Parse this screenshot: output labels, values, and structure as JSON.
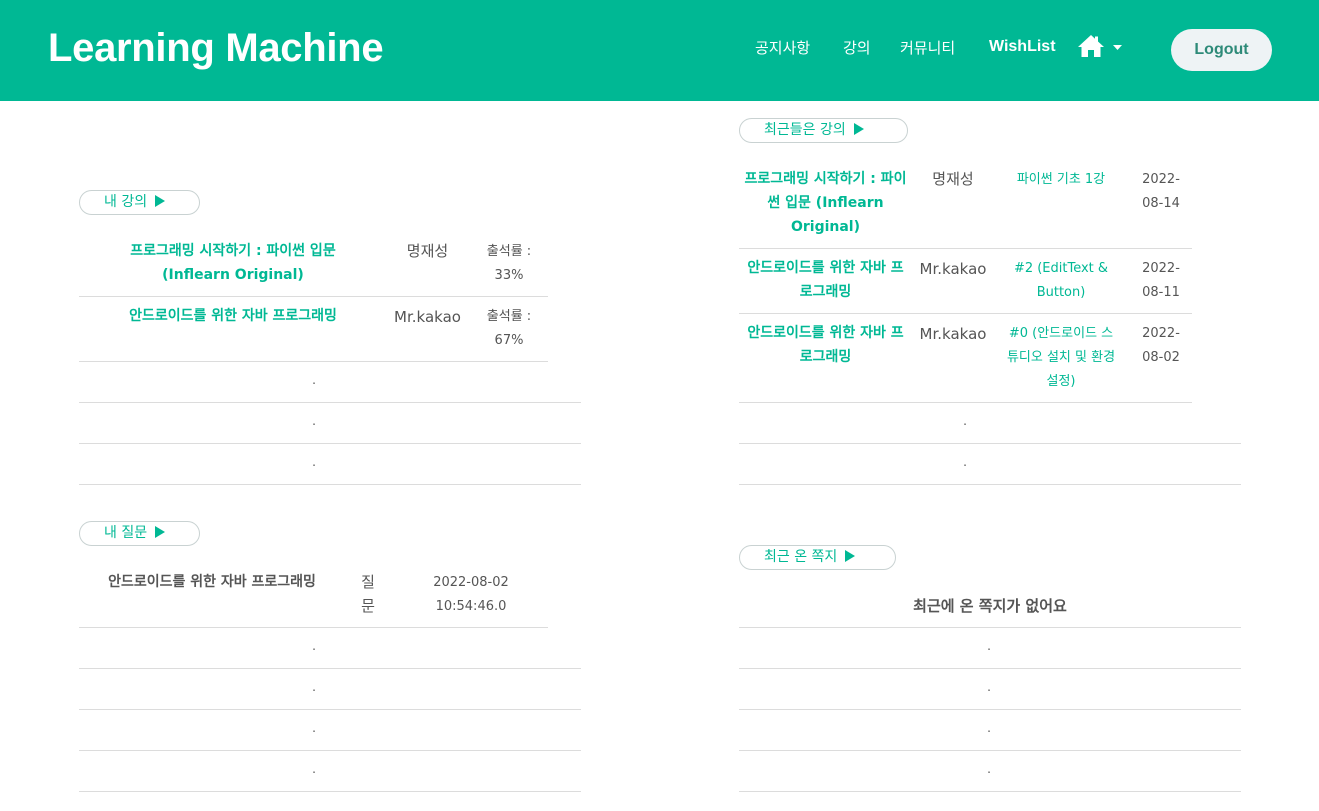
{
  "header": {
    "brand": "Learning Machine",
    "nav": [
      "공지사항",
      "강의",
      "커뮤니티",
      "WishList"
    ],
    "logout": "Logout",
    "color": "#00b894"
  },
  "my_courses": {
    "label": "내 강의",
    "rows": [
      {
        "title": "프로그래밍 시작하기 : 파이썬 입문 (Inflearn Original)",
        "instructor": "명재성",
        "attendance": "출석률 : 33%"
      },
      {
        "title": "안드로이드를 위한 자바 프로그래밍",
        "instructor": "Mr.kakao",
        "attendance": "출석률 : 67%"
      }
    ],
    "placeholders": [
      ".",
      ".",
      "."
    ]
  },
  "my_questions": {
    "label": "내 질문",
    "rows": [
      {
        "title": "안드로이드를 위한 자바 프로그래밍",
        "type": "질문",
        "date": "2022-08-02 10:54:46.0"
      }
    ],
    "placeholders": [
      ".",
      ".",
      ".",
      "."
    ]
  },
  "recent_lectures": {
    "label": "최근들은 강의",
    "rows": [
      {
        "course": "프로그래밍 시작하기 : 파이썬 입문 (Inflearn Original)",
        "instructor": "명재성",
        "lecture": "파이썬 기초 1강",
        "date": "2022-08-14"
      },
      {
        "course": "안드로이드를 위한 자바 프로그래밍",
        "instructor": "Mr.kakao",
        "lecture": "#2 (EditText & Button)",
        "date": "2022-08-11"
      },
      {
        "course": "안드로이드를 위한 자바 프로그래밍",
        "instructor": "Mr.kakao",
        "lecture": "#0 (안드로이드 스튜디오 설치 및 환경설정)",
        "date": "2022-08-02"
      }
    ],
    "placeholders": [
      ".",
      "."
    ]
  },
  "recent_notes": {
    "label": "최근 온 쪽지",
    "empty_message": "최근에 온 쪽지가 없어요",
    "placeholders": [
      ".",
      ".",
      ".",
      "."
    ]
  }
}
